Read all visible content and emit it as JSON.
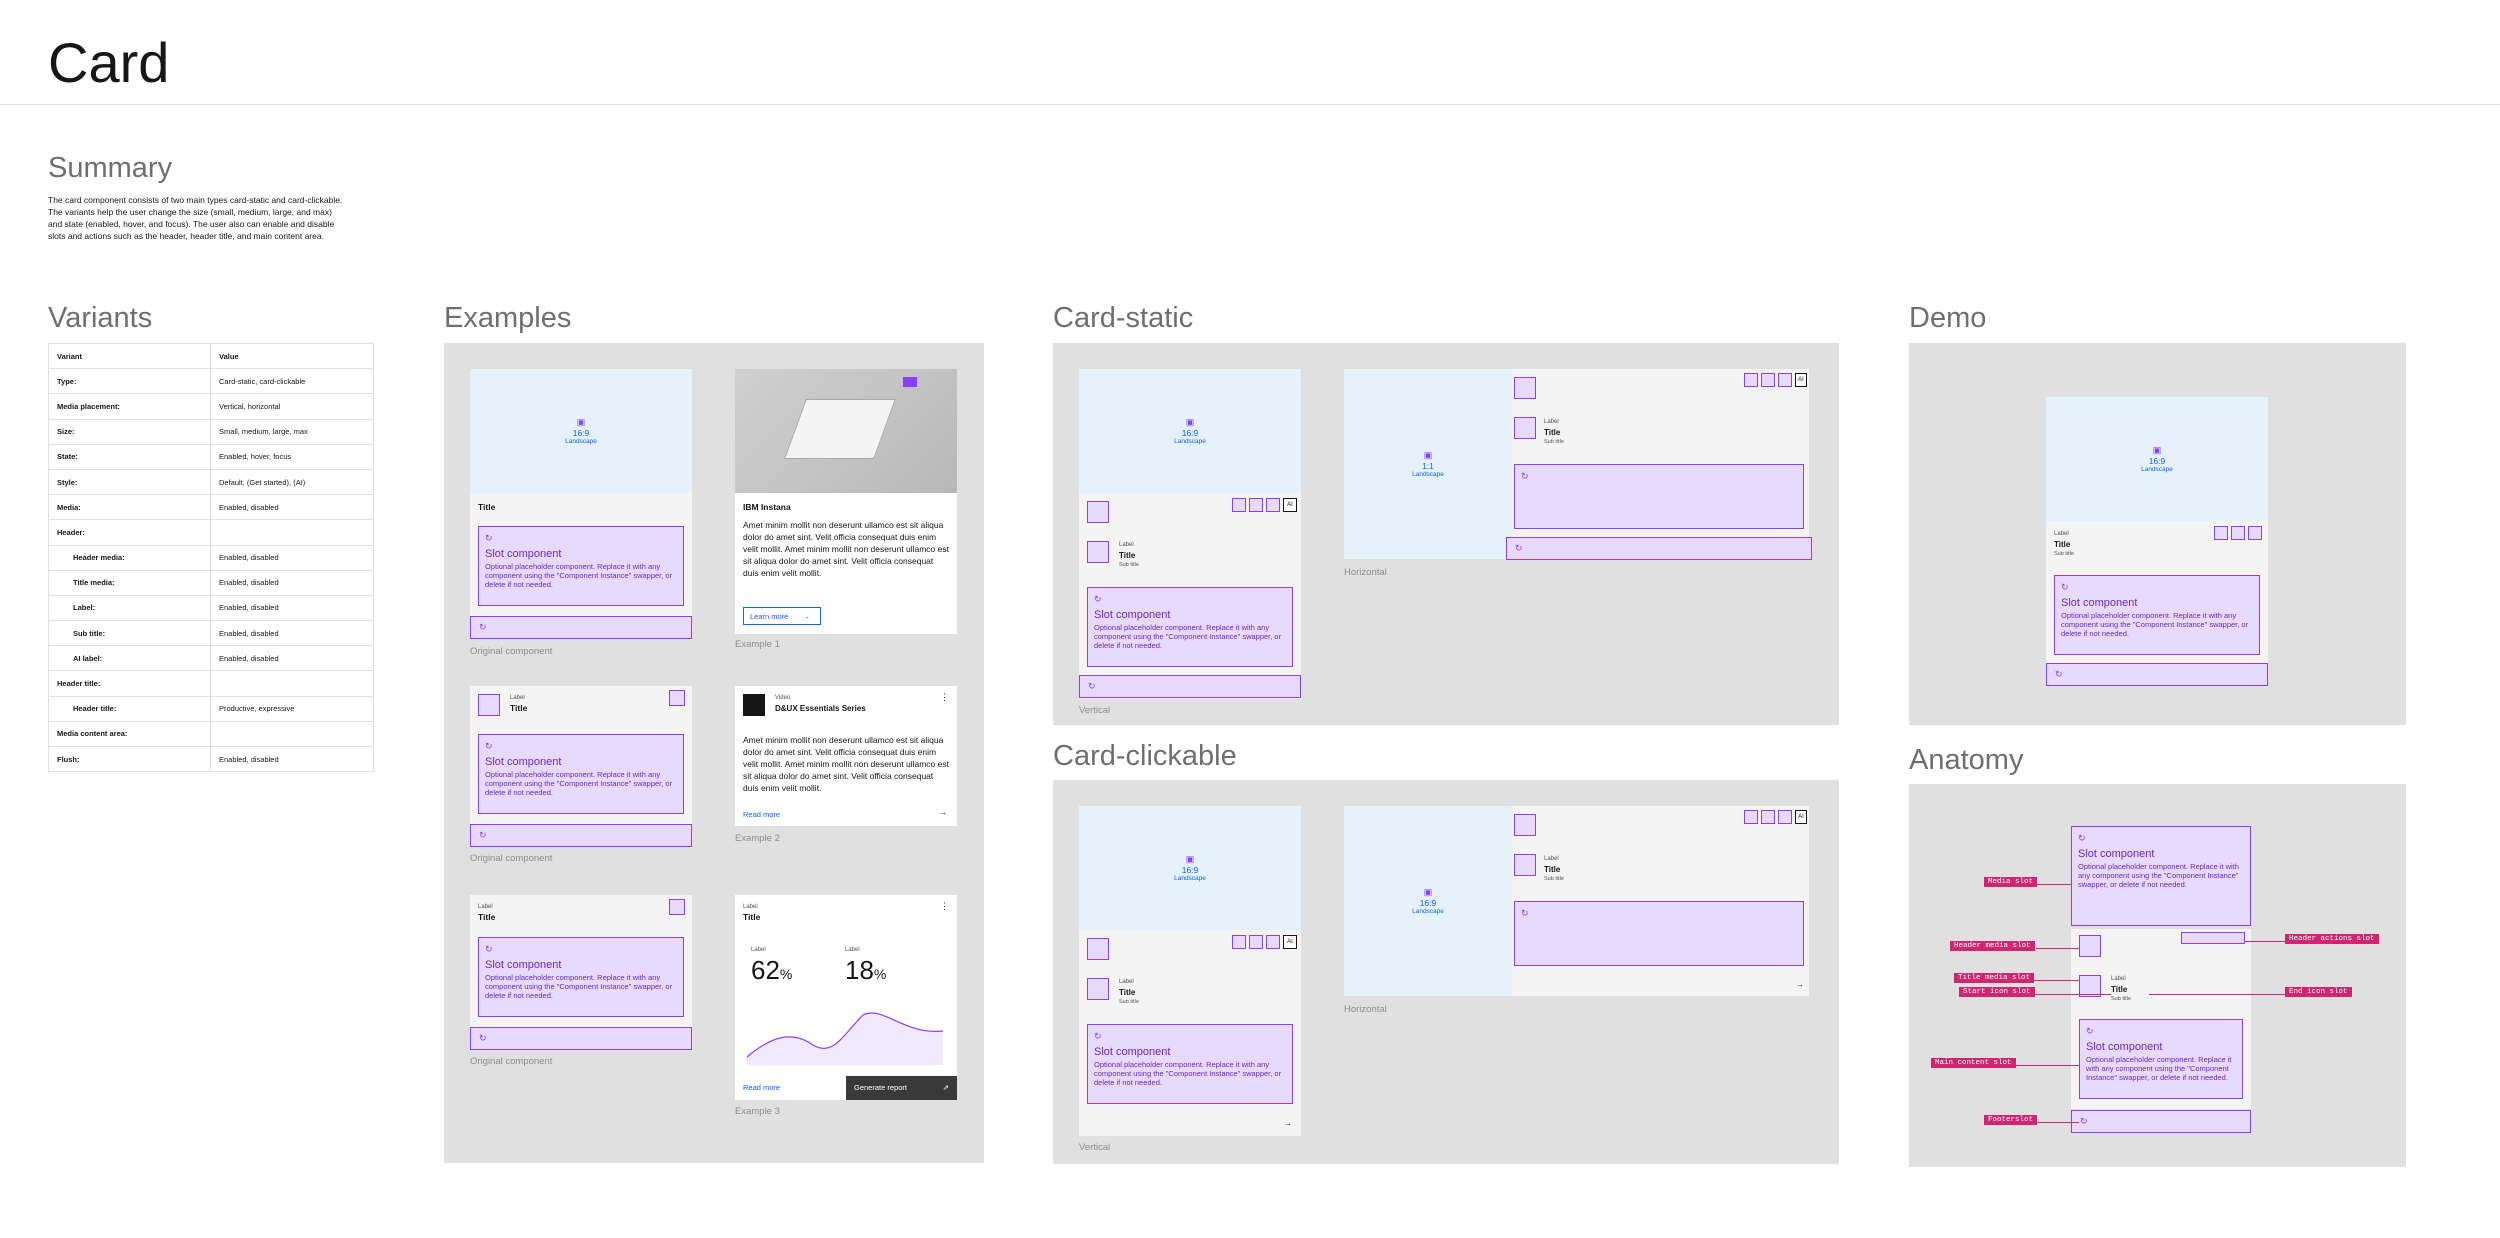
{
  "page": {
    "title": "Card"
  },
  "summary": {
    "heading": "Summary",
    "text": "The card component consists of two main types card-static and card-clickable. The variants help the user change the size (small, medium, large, and max) and state (enabled, hover, and focus). The user also can enable and disable slots and actions such as the header, header title, and main content area."
  },
  "variants": {
    "heading": "Variants",
    "col1": "Variant",
    "col2": "Value",
    "rows": [
      [
        "Type:",
        "Card-static, card-clickable"
      ],
      [
        "Media placement:",
        "Vertical, horizontal"
      ],
      [
        "Size:",
        "Small, medium, large, max"
      ],
      [
        "State:",
        "Enabled, hover, focus"
      ],
      [
        "Style:",
        "Default, (Get started), (AI)"
      ],
      [
        "Media:",
        "Enabled, disabled"
      ],
      [
        "Header:",
        ""
      ],
      [
        "Header media:",
        "Enabled, disabled"
      ],
      [
        "Title media:",
        "Enabled, disabled"
      ],
      [
        "Label:",
        "Enabled, disabled"
      ],
      [
        "Sub title:",
        "Enabled, disabled"
      ],
      [
        "AI label:",
        "Enabled, disabled"
      ],
      [
        "Header title:",
        ""
      ],
      [
        "Header title:",
        "Productive, expressive"
      ],
      [
        "Media content area:",
        ""
      ],
      [
        "Flush:",
        "Enabled, disabled"
      ]
    ]
  },
  "examples": {
    "heading": "Examples",
    "original": "Original component",
    "title": "Title",
    "label": "Label",
    "subtitle": "Sub title",
    "slot_title": "Slot component",
    "slot_desc": "Optional placeholder component. Replace it with any component using the \"Component Instance\" swapper, or delete if not needed.",
    "ratio": "16:9",
    "orient": "Landscape",
    "ex1": {
      "title": "IBM Instana",
      "body": "Amet minim mollit non deserunt ullamco est sit aliqua dolor do amet sint. Velit officia consequat duis enim velit mollit. Amet minim mollit non deserunt ullamco est sit aliqua dolor do amet sint. Velit officia consequat duis enim velit mollit.",
      "btn": "Learn more",
      "cap": "Example 1"
    },
    "ex2": {
      "label": "Video",
      "title": "D&UX Essentials Series",
      "body": "Amet minim mollit non deserunt ullamco est sit aliqua dolor do amet sint. Velit officia consequat duis enim velit mollit. Amet minim mollit non deserunt ullamco est sit aliqua dolor do amet sint. Velit officia consequat duis enim velit mollit.",
      "link": "Read more",
      "cap": "Example 2"
    },
    "ex3": {
      "label": "Label",
      "title": "Title",
      "stat1_label": "Label",
      "stat1": "62",
      "stat2_label": "Label",
      "stat2": "18",
      "unit": "%",
      "link": "Read more",
      "btn": "Generate report",
      "cap": "Example 3"
    }
  },
  "static": {
    "heading": "Card-static",
    "vertical": "Vertical",
    "horizontal": "Horizontal",
    "ratio11": "1:1"
  },
  "clickable": {
    "heading": "Card-clickable"
  },
  "demo": {
    "heading": "Demo"
  },
  "anatomy": {
    "heading": "Anatomy",
    "tags": [
      "Media slot",
      "Header media slot",
      "Title media slot",
      "Start icon slot",
      "Main content slot",
      "Footerslot",
      "Header actions slot",
      "End icon slot"
    ]
  },
  "ai": "AI"
}
